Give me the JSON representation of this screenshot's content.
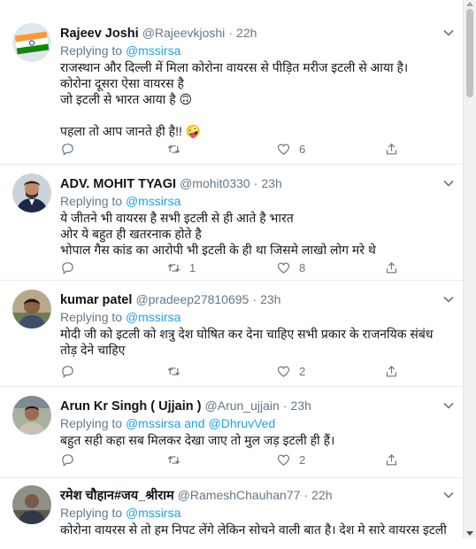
{
  "tweets": [
    {
      "name": "Rajeev Joshi",
      "handle": "@Rajeevkjoshi",
      "dot": "·",
      "time": "22h",
      "replying_prefix": "Replying to",
      "mentions": "@mssirsa",
      "lines": [
        "राजस्थान और दिल्ली में मिला कोरोना वायरस से पीड़ित मरीज इटली से आया है।",
        "कोरोना दूसरा ऐसा वायरस है",
        "जो इटली से भारत आया है 🙃",
        "",
        "पहला तो आप जानते ही है!! 🤪"
      ],
      "retweets": "",
      "likes": "6"
    },
    {
      "name": "ADV. MOHIT TYAGI",
      "handle": "@mohit0330",
      "dot": "·",
      "time": "23h",
      "replying_prefix": "Replying to",
      "mentions": "@mssirsa",
      "lines": [
        "ये जीतने भी वायरस है सभी इटली से ही आते है भारत",
        "ओर ये बहुत ही खतरनाक होते  है",
        "भोपाल गैस कांड का आरोपी भी इटली के ही था जिसमे लाखो लोग  मरे थे"
      ],
      "retweets": "1",
      "likes": "8"
    },
    {
      "name": "kumar patel",
      "handle": "@pradeep27810695",
      "dot": "·",
      "time": "23h",
      "replying_prefix": "Replying to",
      "mentions": "@mssirsa",
      "lines": [
        "मोदी जी को इटली को शत्रु देश घोषित कर देना चाहिए सभी प्रकार के राजनयिक संबंध",
        "तोड़ देने चाहिए"
      ],
      "retweets": "",
      "likes": "2"
    },
    {
      "name": "Arun Kr Singh ( Ujjain )",
      "handle": "@Arun_ujjain",
      "dot": "·",
      "time": "23h",
      "replying_prefix": "Replying to",
      "mentions": "@mssirsa and @DhruvVed",
      "lines": [
        "बहुत सही कहा सब मिलकर देखा जाए तो मुल जड़ इटली ही हैं।"
      ],
      "retweets": "",
      "likes": "2"
    },
    {
      "name": "रमेश चौहान#जय_श्रीराम",
      "handle": "@RameshChauhan77",
      "dot": "·",
      "time": "22h",
      "replying_prefix": "Replying to",
      "mentions": "@mssirsa",
      "lines": [
        "कोरोना वायरस से तो हम निपट लेंगे लेकिन सोचने वाली बात है। देश मे सारे वायरस इटली"
      ],
      "retweets": "",
      "likes": ""
    }
  ],
  "colors": {
    "accent": "#1da1f2",
    "muted": "#657786",
    "divider": "#e6ecf0"
  },
  "icons": [
    "reply-icon",
    "retweet-icon",
    "like-icon",
    "share-icon",
    "chevron-down-icon"
  ]
}
